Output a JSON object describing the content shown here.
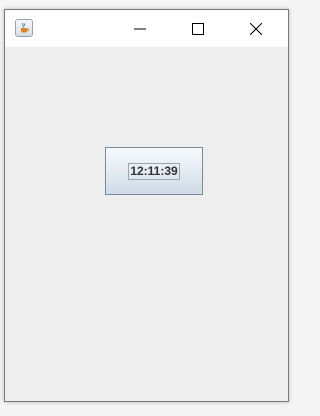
{
  "window": {
    "title": "",
    "icon": "java-cup-icon"
  },
  "titlebar": {
    "controls": [
      {
        "name": "minimize",
        "icon": "minimize-icon"
      },
      {
        "name": "maximize",
        "icon": "maximize-icon"
      },
      {
        "name": "close",
        "icon": "close-icon"
      }
    ]
  },
  "clock": {
    "time": "12:11:39"
  },
  "colors": {
    "content_background": "#eeeeee",
    "titlebar_background": "#ffffff",
    "button_border": "#7a8a99"
  }
}
